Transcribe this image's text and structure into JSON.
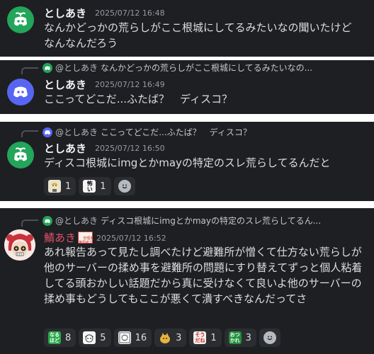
{
  "messages": [
    {
      "author": "としあき",
      "timestamp": "2025/07/12 16:48",
      "text": "なんかどっかの荒らしがここ根城にしてるみたいなの聞いたけどなんなんだろう"
    },
    {
      "reply_to": {
        "mention": "@としあき",
        "snippet": "なんかどっかの荒らしがここ根城にしてるみたいなの..."
      },
      "author": "としあき",
      "timestamp": "2025/07/12 16:49",
      "text": "ここってどこだ...ふたば？　ディスコ？"
    },
    {
      "reply_to": {
        "mention": "@としあき",
        "snippet": "ここってどこだ...ふたば？　ディスコ？"
      },
      "author": "としあき",
      "timestamp": "2025/07/12 16:50",
      "text": "ディスコ根城にimgとかmayの特定のスレ荒らしてるんだと",
      "reactions": [
        {
          "icon": "character-face-emoji",
          "count": "1"
        },
        {
          "icon": "text-sticker-emoji",
          "label": "怖い",
          "count": "1"
        }
      ]
    },
    {
      "reply_to": {
        "mention": "@としあき",
        "snippet": "ディスコ根城にimgとかmayの特定のスレ荒らしてるん..."
      },
      "author": "鯖あき",
      "badge": "管理者\n権限者です",
      "timestamp": "2025/07/12 16:52",
      "text": "あれ報告あって見たし調べたけど避難所が憎くて仕方ない荒らしが他のサーバーの揉め事を避難所の問題にすり替えてずっと個人粘着してる頭おかしい話題だから真に受けなくて良いよ他のサーバーの揉め事もどうしてもここが悪くて潰すべきなんだってさ",
      "reactions": [
        {
          "icon": "naruhodo-emoji",
          "label": "なる\nほど",
          "count": "8"
        },
        {
          "icon": "manga-face-emoji",
          "count": "5"
        },
        {
          "icon": "manga-panel-emoji",
          "count": "16"
        },
        {
          "icon": "yellow-creature-emoji",
          "count": "3"
        },
        {
          "icon": "souda-emoji",
          "label": "そう\nだね",
          "count": "1"
        },
        {
          "icon": "otsukare-emoji",
          "label": "おつ\nかれ",
          "count": "3"
        }
      ]
    }
  ],
  "colors": {
    "background": "#1e1f22",
    "author": "#f2f3f5",
    "admin_author": "#e2506b",
    "text": "#dbdee1",
    "timestamp": "#949ba4",
    "discord_green": "#23a55a",
    "discord_blurple": "#5865f2"
  }
}
